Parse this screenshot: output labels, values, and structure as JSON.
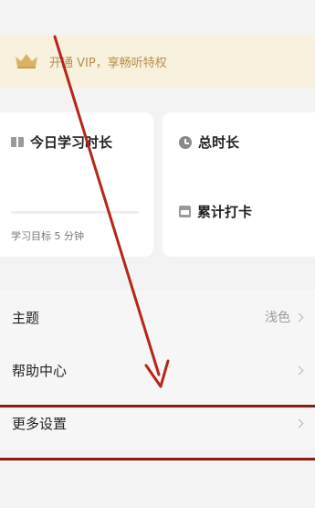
{
  "vip": {
    "text": "开通 VIP，享畅听特权",
    "icon": "crown-icon"
  },
  "stats": {
    "today": {
      "title": "今日学习时长",
      "goal": "学习目标 5 分钟",
      "progress": 0
    },
    "total": {
      "title": "总时长"
    },
    "checkin": {
      "title": "累计打卡"
    }
  },
  "menu": [
    {
      "label": "主题",
      "value": "浅色"
    },
    {
      "label": "帮助中心",
      "value": ""
    },
    {
      "label": "更多设置",
      "value": ""
    }
  ],
  "annotation": {
    "arrow_color": "#b5251b",
    "box_color": "#8c1c13"
  }
}
